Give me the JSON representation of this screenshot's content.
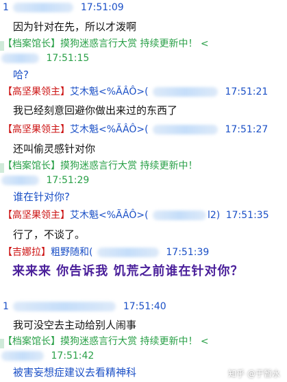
{
  "messages": [
    {
      "tag": "",
      "name": "1",
      "suffix": "",
      "time": "17:51:09",
      "text": "因为针对在先，所以才泼啊",
      "green": false
    },
    {
      "tag": "【档案馆长】",
      "name": "摸狗迷惑言行大赏 持续更新中！",
      "suffix": "<",
      "time": "17:51:15",
      "text": "哈?",
      "green": true
    },
    {
      "tag": "【高坚果领主】",
      "name": "艾木魁<%ÃÂÔ>(",
      "suffix": "",
      "time": "17:51:21",
      "text": "我已经刻意回避你做出来过的东西了",
      "green": false
    },
    {
      "tag": "【高坚果领主】",
      "name": "艾木魁<%ÃÂÔ>(",
      "suffix": "",
      "time": "17:51:27",
      "text": "还叫偷灵感针对你",
      "green": false
    },
    {
      "tag": "【档案馆长】",
      "name": "摸狗迷惑言行大赏 持续更新中！",
      "suffix": "",
      "time": "17:51:29",
      "text": "谁在针对你?",
      "green": true
    },
    {
      "tag": "【高坚果领主】",
      "name": "艾木魁<%ÃÂÔ>(",
      "suffix": "l2)",
      "time": "17:51:35",
      "text": "行了，不谈了。",
      "green": false
    },
    {
      "tag": "【吉娜拉】",
      "name": "粗野随和(",
      "suffix": "",
      "time": "17:51:39",
      "text": "来来来 你告诉我 饥荒之前谁在针对你？",
      "green": false
    },
    {
      "tag": "",
      "name": "1",
      "suffix": "",
      "time": "17:51:40",
      "text": "我可没空去主动给别人闹事",
      "green": false
    },
    {
      "tag": "【档案馆长】",
      "name": "摸狗迷惑言行大赏 持续更新中！",
      "suffix": "<",
      "time": "17:51:42",
      "text": "被害妄想症建议去看精神科",
      "green": true
    }
  ],
  "watermark": {
    "text": "知乎 @于暂水"
  },
  "colors": {
    "blue": "#1a4fc6",
    "green": "#2aa048",
    "red": "#cc1111",
    "purple": "#4a1f9a"
  }
}
